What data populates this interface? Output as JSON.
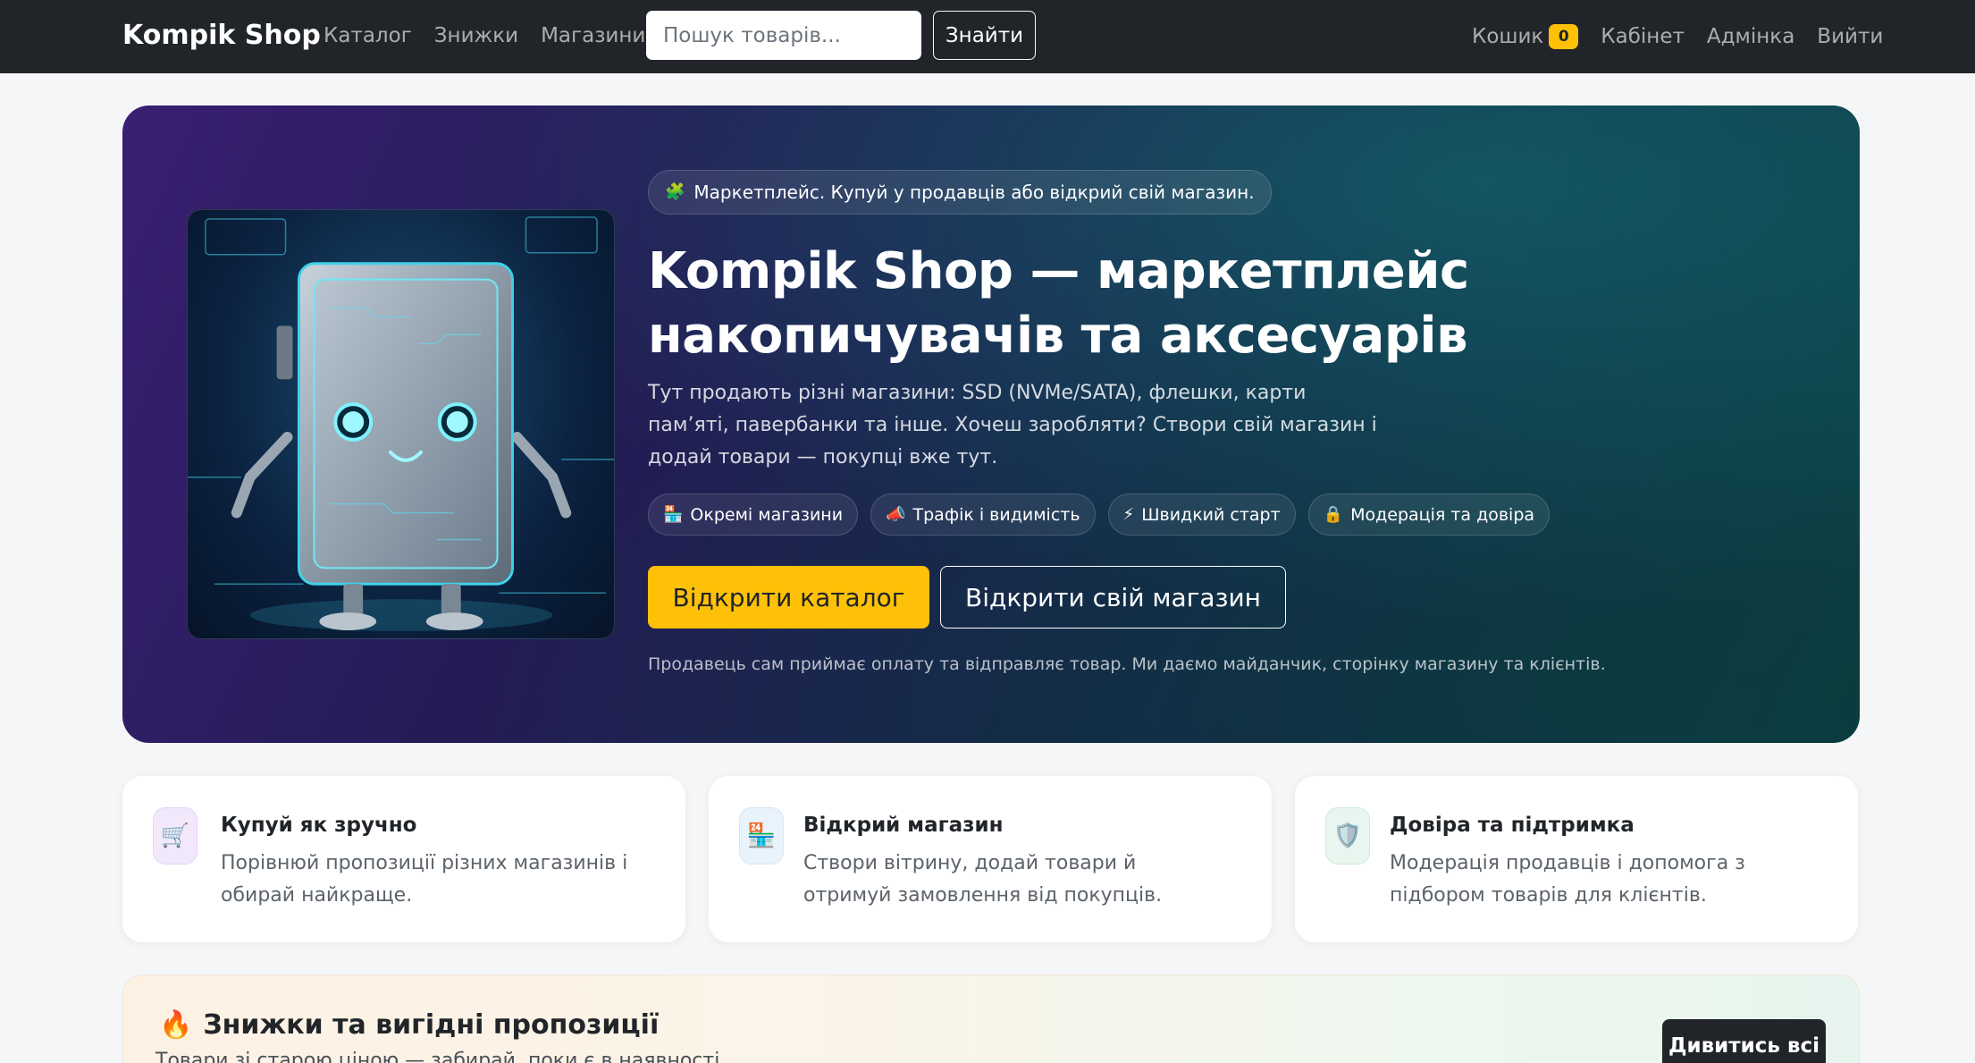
{
  "navbar": {
    "brand": "Kompik Shop",
    "links": [
      "Каталог",
      "Знижки",
      "Магазини"
    ],
    "search_placeholder": "Пошук товарів...",
    "search_button": "Знайти",
    "cart_label": "Кошик",
    "cart_count": "0",
    "cabinet": "Кабінет",
    "admin": "Адмінка",
    "logout": "Вийти"
  },
  "hero": {
    "pill_text": "Маркетплейс. Купуй у продавців або відкрий свій магазин.",
    "title": "Kompik Shop — маркетплейс накопичувачів та аксесуарів",
    "subtitle": "Тут продають різні магазини: SSD (NVMe/SATA), флешки, карти пам’яті, павербанки та інше. Хочеш заробляти? Створи свій магазин і додай товари — покупці вже тут.",
    "features": [
      {
        "icon": "🏪",
        "label": "Окремі магазини"
      },
      {
        "icon": "📣",
        "label": "Трафік і видимість"
      },
      {
        "icon": "⚡",
        "label": "Швидкий старт"
      },
      {
        "icon": "🔒",
        "label": "Модерація та довіра"
      }
    ],
    "btn_catalog": "Відкрити каталог",
    "btn_store": "Відкрити свій магазин",
    "note": "Продавець сам приймає оплату та відправляє товар. Ми даємо майданчик, сторінку магазину та клієнтів."
  },
  "cards": [
    {
      "icon": "🛒",
      "title": "Купуй як зручно",
      "text": "Порівнюй пропозиції різних магазинів і обирай найкраще."
    },
    {
      "icon": "🏪",
      "title": "Відкрий магазин",
      "text": "Створи вітрину, додай товари й отримуй замовлення від покупців."
    },
    {
      "icon": "🛡️",
      "title": "Довіра та підтримка",
      "text": "Модерація продавців і допомога з підбором товарів для клієнтів."
    }
  ],
  "discounts": {
    "icon": "🔥",
    "title": "Знижки та вигідні пропозиції",
    "subtitle": "Товари зі старою ціною — забирай, поки є в наявності.",
    "button": "Дивитись всі"
  },
  "colors": {
    "navbar_bg": "#212529",
    "accent_yellow": "#ffc107",
    "hero_purple": "#3a1f73",
    "hero_teal": "#0b3d42"
  }
}
